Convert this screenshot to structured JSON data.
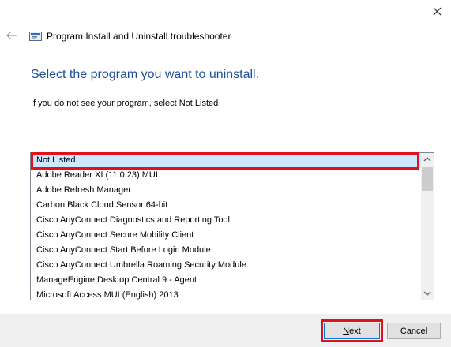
{
  "window": {
    "title": "Program Install and Uninstall troubleshooter",
    "icons": {
      "close": "close-icon",
      "back": "back-arrow-icon",
      "app": "troubleshooter-app-icon"
    }
  },
  "page": {
    "heading": "Select the program you want to uninstall.",
    "instruction": "If you do not see your program, select Not Listed"
  },
  "program_list": {
    "selected_index": 0,
    "items": [
      "Not Listed",
      "Adobe Reader XI (11.0.23)  MUI",
      "Adobe Refresh Manager",
      "Carbon Black Cloud Sensor 64-bit",
      "Cisco AnyConnect Diagnostics and Reporting Tool",
      "Cisco AnyConnect Secure Mobility Client",
      "Cisco AnyConnect Start Before Login Module",
      "Cisco AnyConnect Umbrella Roaming Security Module",
      "ManageEngine Desktop Central 9 - Agent",
      "Microsoft Access MUI (English) 2013"
    ]
  },
  "buttons": {
    "next_accel": "N",
    "next_rest": "ext",
    "cancel": "Cancel"
  },
  "colors": {
    "heading": "#1b4f9c",
    "selection": "#cce8ff",
    "annotation_red": "#e0101c"
  }
}
